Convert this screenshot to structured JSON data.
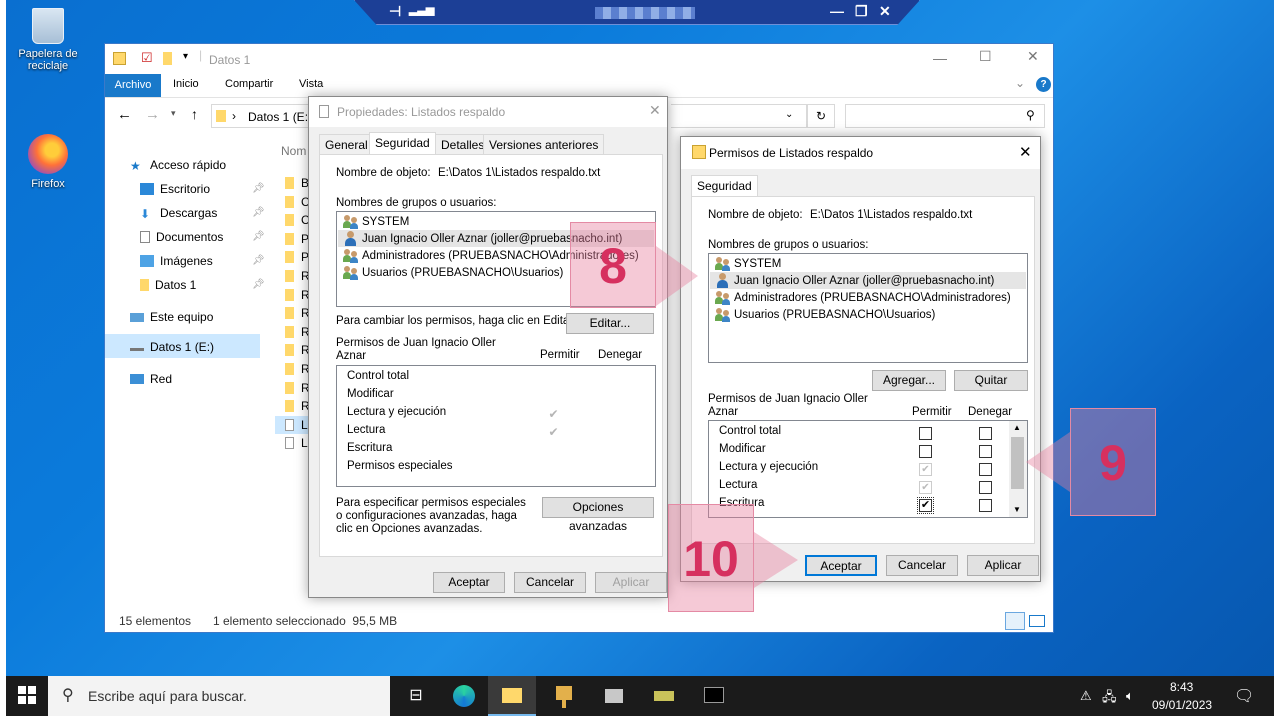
{
  "desktop": {
    "recycle_bin": "Papelera de reciclaje",
    "firefox": "Firefox"
  },
  "explorer": {
    "title": "Datos 1",
    "ribbon_tabs": [
      "Archivo",
      "Inicio",
      "Compartir",
      "Vista"
    ],
    "address": "Datos 1 (E:)",
    "column_header": "Nom",
    "nav": [
      "Acceso rápido",
      "Escritorio",
      "Descargas",
      "Documentos",
      "Imágenes",
      "Datos 1",
      "Este equipo",
      "Datos 1 (E:)",
      "Red"
    ],
    "file_letters": [
      "B",
      "C",
      "C",
      "P",
      "P",
      "R",
      "R",
      "R",
      "R",
      "R",
      "R",
      "R",
      "R",
      "Li",
      "Li"
    ],
    "status_count": "15 elementos",
    "status_selection": "1 elemento seleccionado  95,5 MB"
  },
  "props": {
    "title": "Propiedades: Listados respaldo",
    "tabs": [
      "General",
      "Seguridad",
      "Detalles",
      "Versiones anteriores"
    ],
    "object_label": "Nombre de objeto:",
    "object_value": "E:\\Datos 1\\Listados respaldo.txt",
    "groups_label": "Nombres de grupos o usuarios:",
    "users": [
      "SYSTEM",
      "Juan Ignacio Oller Aznar (joller@pruebasnacho.int)",
      "Administradores (PRUEBASNACHO\\Administradores)",
      "Usuarios (PRUEBASNACHO\\Usuarios)"
    ],
    "change_text": "Para cambiar los permisos, haga clic en Editar.",
    "edit_button": "Editar...",
    "perms_for": "Permisos de Juan Ignacio Oller Aznar",
    "allow": "Permitir",
    "deny": "Denegar",
    "permissions": [
      "Control total",
      "Modificar",
      "Lectura y ejecución",
      "Lectura",
      "Escritura",
      "Permisos especiales"
    ],
    "special_text": "Para especificar permisos especiales o configuraciones avanzadas, haga clic en Opciones avanzadas.",
    "advanced_button": "Opciones avanzadas",
    "ok": "Aceptar",
    "cancel": "Cancelar",
    "apply": "Aplicar"
  },
  "perms": {
    "title": "Permisos de Listados respaldo",
    "tab": "Seguridad",
    "object_label": "Nombre de objeto:",
    "object_value": "E:\\Datos 1\\Listados respaldo.txt",
    "groups_label": "Nombres de grupos o usuarios:",
    "users": [
      "SYSTEM",
      "Juan Ignacio Oller Aznar (joller@pruebasnacho.int)",
      "Administradores (PRUEBASNACHO\\Administradores)",
      "Usuarios (PRUEBASNACHO\\Usuarios)"
    ],
    "add": "Agregar...",
    "remove": "Quitar",
    "perms_for": "Permisos de Juan Ignacio Oller Aznar",
    "allow": "Permitir",
    "deny": "Denegar",
    "permissions": [
      "Control total",
      "Modificar",
      "Lectura y ejecución",
      "Lectura",
      "Escritura"
    ],
    "ok": "Aceptar",
    "cancel": "Cancelar",
    "apply": "Aplicar"
  },
  "annotations": {
    "a8": "8",
    "a9": "9",
    "a10": "10"
  },
  "taskbar": {
    "search_placeholder": "Escribe aquí para buscar.",
    "time": "8:43",
    "date": "09/01/2023"
  }
}
